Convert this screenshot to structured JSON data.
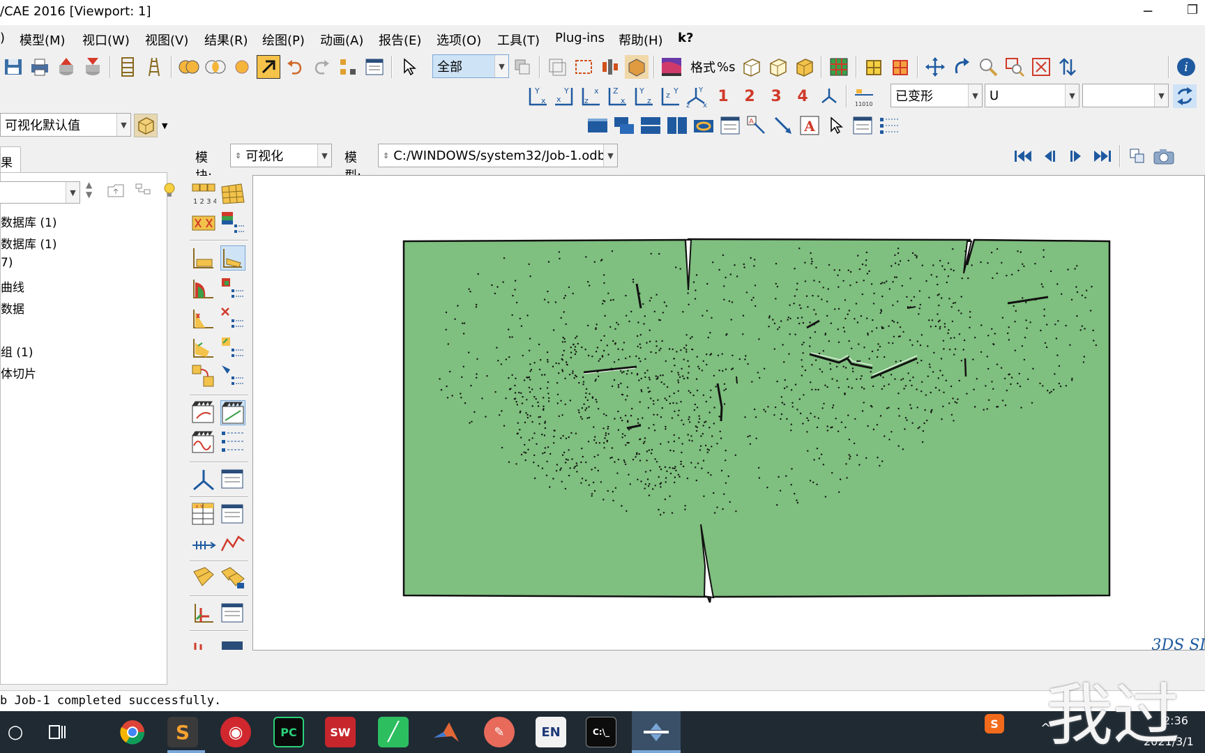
{
  "window": {
    "title": "/CAE 2016 [Viewport: 1]"
  },
  "menu": [
    {
      "id": "m0",
      "label": ")"
    },
    {
      "id": "model",
      "label": "模型(M)"
    },
    {
      "id": "viewport",
      "label": "视口(W)"
    },
    {
      "id": "view",
      "label": "视图(V)"
    },
    {
      "id": "result",
      "label": "结果(R)"
    },
    {
      "id": "plot",
      "label": "绘图(P)"
    },
    {
      "id": "animate",
      "label": "动画(A)"
    },
    {
      "id": "report",
      "label": "报告(E)"
    },
    {
      "id": "options",
      "label": "选项(O)"
    },
    {
      "id": "tools",
      "label": "工具(T)"
    },
    {
      "id": "plugins",
      "label": "Plug-ins"
    },
    {
      "id": "help",
      "label": "帮助(H)"
    },
    {
      "id": "whatsthis",
      "label": "k?"
    }
  ],
  "toolbar": {
    "selection_value": "全部",
    "format_label": "格式",
    "format_value": "%s",
    "csys_numbers": [
      "1",
      "2",
      "3",
      "4"
    ],
    "deform_value": "已变形",
    "variable_value": "U",
    "component_value": ""
  },
  "defaults_combo": {
    "value": "可视化默认值"
  },
  "results_tab": {
    "label": "果"
  },
  "tree": [
    "数据库 (1)",
    "数据库 (1)",
    "7)",
    "曲线",
    "数据",
    "",
    "组 (1)",
    "体切片",
    "",
    "",
    ""
  ],
  "module_bar": {
    "module_label": "模块:",
    "module_value": "可视化",
    "model_label": "模型:",
    "model_value": "C:/WINDOWS/system32/Job-1.odb"
  },
  "message": "b Job-1 completed successfully.",
  "brand": "3DS SI",
  "taskbar": {
    "clock_time": "2:36",
    "clock_date": "2021/3/1",
    "apps": [
      "search",
      "task-view",
      "chrome",
      "sublime",
      "netease-music",
      "pycharm",
      "solidworks",
      "evernote",
      "matlab",
      "app",
      "EN",
      "terminal",
      "abaqus"
    ]
  },
  "watermark": "我过"
}
